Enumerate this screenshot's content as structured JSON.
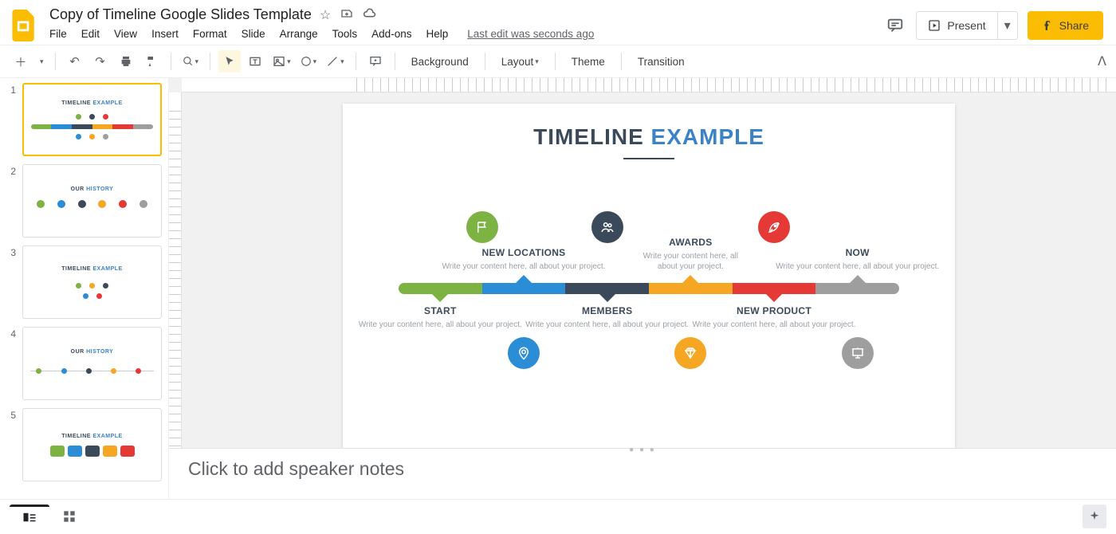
{
  "doc_title": "Copy of Timeline Google Slides Template",
  "last_edit": "Last edit was seconds ago",
  "menu": [
    "File",
    "Edit",
    "View",
    "Insert",
    "Format",
    "Slide",
    "Arrange",
    "Tools",
    "Add-ons",
    "Help"
  ],
  "header": {
    "present": "Present",
    "share": "Share"
  },
  "toolbar": {
    "background": "Background",
    "layout": "Layout",
    "theme": "Theme",
    "transition": "Transition"
  },
  "thumbs": [
    "1",
    "2",
    "3",
    "4",
    "5"
  ],
  "thumb_titles": {
    "t1a": "TIMELINE ",
    "t1b": "EXAMPLE",
    "t2a": "OUR ",
    "t2b": "HISTORY",
    "t3a": "TIMELINE ",
    "t3b": "EXAMPLE",
    "t4a": "OUR ",
    "t4b": "HISTORY",
    "t5a": "TIMELINE ",
    "t5b": "EXAMPLE"
  },
  "slide": {
    "title1": "TIMELINE ",
    "title2": "EXAMPLE",
    "desc": "Write your content here, all about your project.",
    "milestones": {
      "start": "START",
      "new_locations": "NEW LOCATIONS",
      "members": "MEMBERS",
      "awards": "AWARDS",
      "new_product": "NEW PRODUCT",
      "now": "NOW"
    }
  },
  "notes_placeholder": "Click to add speaker notes",
  "colors": {
    "green": "#7cb342",
    "blue": "#2b8dd6",
    "dark": "#3b4a5a",
    "orange": "#f5a623",
    "red": "#e53935",
    "grey": "#9e9e9e"
  }
}
